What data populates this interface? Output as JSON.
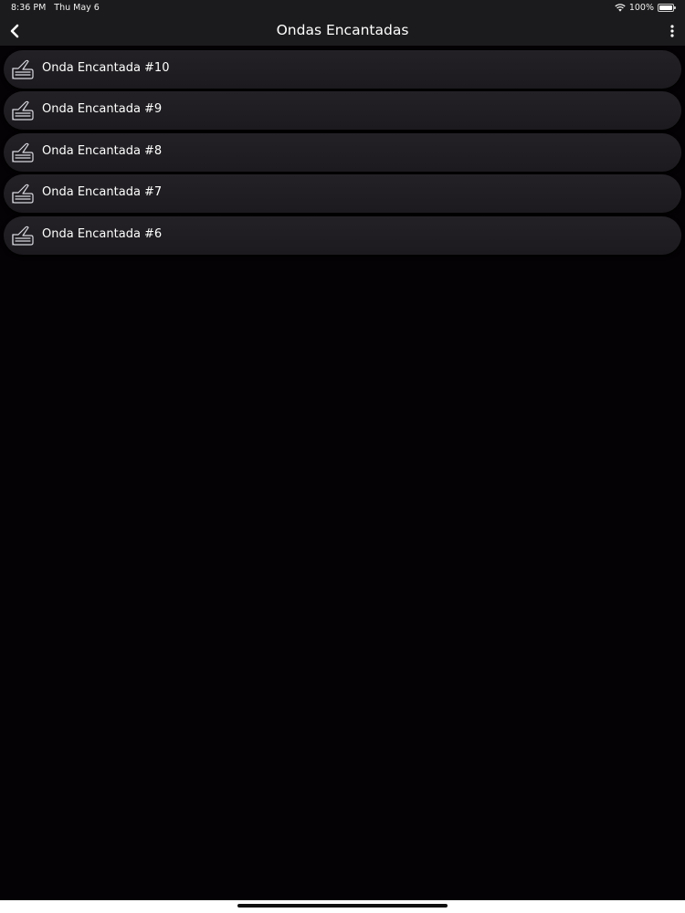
{
  "status_bar": {
    "time": "8:36 PM",
    "date": "Thu May 6",
    "battery": "100%",
    "battery_level": 1.0,
    "wifi_icon": "wifi-icon",
    "battery_icon": "battery-icon"
  },
  "nav": {
    "title": "Ondas Encantadas",
    "back_icon": "chevron-left-icon",
    "more_icon": "more-vertical-icon"
  },
  "list": {
    "item_icon": "writing-hand-icon",
    "items": [
      {
        "label": "Onda Encantada #10"
      },
      {
        "label": "Onda Encantada #9"
      },
      {
        "label": "Onda Encantada #8"
      },
      {
        "label": "Onda Encantada #7"
      },
      {
        "label": "Onda Encantada #6"
      }
    ]
  },
  "colors": {
    "background": "#040204",
    "bar": "#1b1a1c",
    "list_item": "#221f23",
    "text": "#ffffff"
  }
}
